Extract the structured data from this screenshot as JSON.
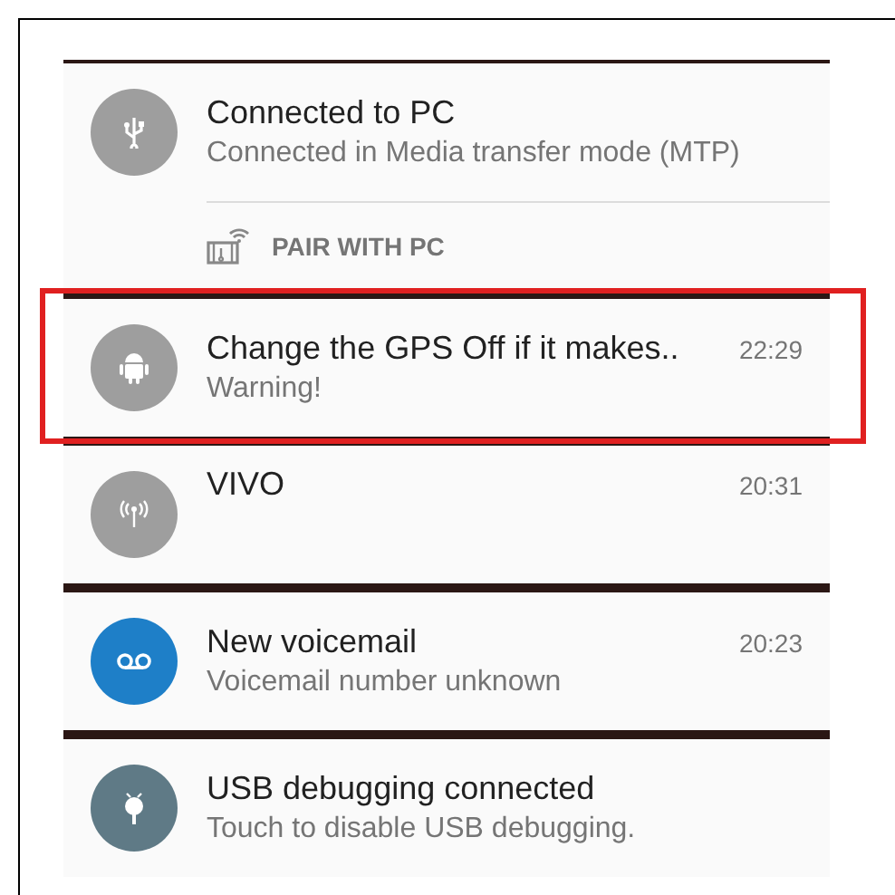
{
  "notifications": [
    {
      "kind": "usb",
      "color": "#9e9e9e",
      "title": "Connected to PC",
      "text": "Connected in Media transfer mode (MTP)",
      "action": "PAIR WITH PC",
      "highlighted": false
    },
    {
      "kind": "android",
      "color": "#9e9e9e",
      "title": "Change the GPS Off if it makes..",
      "text": "Warning!",
      "time": "22:29",
      "highlighted": true
    },
    {
      "kind": "antenna",
      "color": "#9e9e9e",
      "title": "VIVO",
      "time": "20:31",
      "highlighted": false
    },
    {
      "kind": "voicemail",
      "color": "#1e7fc8",
      "title": "New voicemail",
      "text": "Voicemail number unknown",
      "time": "20:23",
      "highlighted": false
    },
    {
      "kind": "debug",
      "color": "#5f7a86",
      "title": "USB debugging connected",
      "text": "Touch to disable USB debugging.",
      "highlighted": false
    }
  ]
}
